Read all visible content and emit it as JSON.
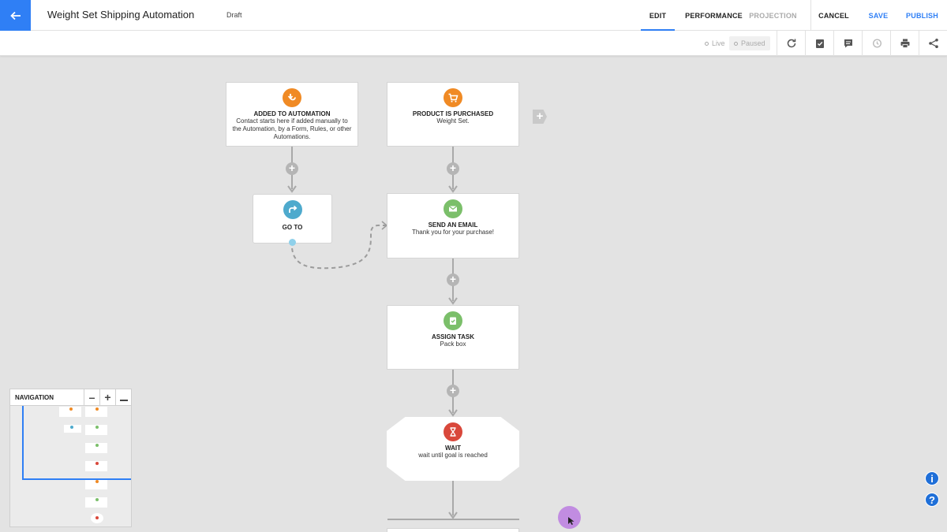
{
  "header": {
    "title": "Weight Set Shipping Automation",
    "status": "Draft",
    "nav": [
      {
        "label": "EDIT"
      },
      {
        "label": "PERFORMANCE"
      },
      {
        "label": "PROJECTION"
      },
      {
        "label": "CANCEL"
      },
      {
        "label": "SAVE"
      },
      {
        "label": "PUBLISH"
      }
    ]
  },
  "toolbar": {
    "live_label": "Live",
    "paused_label": "Paused"
  },
  "nodes": {
    "added": {
      "title": "ADDED TO AUTOMATION",
      "desc": "Contact starts here if added manually to the Automation, by a Form, Rules, or other Automations."
    },
    "product": {
      "title": "PRODUCT IS PURCHASED",
      "desc": "Weight Set."
    },
    "goto": {
      "title": "GO TO"
    },
    "email": {
      "title": "SEND AN EMAIL",
      "desc": "Thank you for your purchase!"
    },
    "task": {
      "title": "ASSIGN TASK",
      "desc": "Pack box"
    },
    "wait": {
      "title": "WAIT",
      "desc": "wait until goal is reached"
    }
  },
  "navigation": {
    "title": "NAVIGATION"
  },
  "colors": {
    "accent": "#2f7ff5",
    "orange": "#f08a24",
    "green": "#7bbf6a",
    "teal": "#4eaacd",
    "red": "#d9483b"
  }
}
